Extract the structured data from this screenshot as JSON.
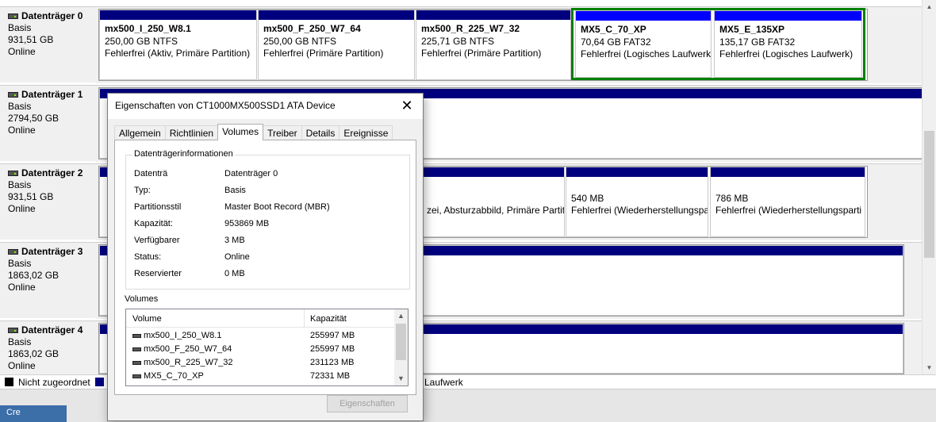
{
  "disks": [
    {
      "name": "Datenträger 0",
      "type": "Basis",
      "size": "931,51 GB",
      "status": "Online",
      "partitions": [
        {
          "name": "mx500_I_250_W8.1",
          "size": "250,00 GB NTFS",
          "status": "Fehlerfrei (Aktiv, Primäre Partition)"
        },
        {
          "name": "mx500_F_250_W7_64",
          "size": "250,00 GB NTFS",
          "status": "Fehlerfrei (Primäre Partition)"
        },
        {
          "name": "mx500_R_225_W7_32",
          "size": "225,71 GB NTFS",
          "status": "Fehlerfrei (Primäre Partition)"
        },
        {
          "name": "MX5_C_70_XP",
          "size": "70,64 GB FAT32",
          "status": "Fehlerfrei (Logisches Laufwerk"
        },
        {
          "name": "MX5_E_135XP",
          "size": "135,17 GB FAT32",
          "status": "Fehlerfrei (Logisches Laufwerk)"
        }
      ]
    },
    {
      "name": "Datenträger 1",
      "type": "Basis",
      "size": "2794,50 GB",
      "status": "Online"
    },
    {
      "name": "Datenträger 2",
      "type": "Basis",
      "size": "931,51 GB",
      "status": "Online",
      "partitions": [
        {
          "name": "",
          "size": "",
          "status": "zei, Absturzabbild, Primäre Partit"
        },
        {
          "name": "",
          "size": "540 MB",
          "status": "Fehlerfrei (Wiederherstellungspa"
        },
        {
          "name": "",
          "size": "786 MB",
          "status": "Fehlerfrei (Wiederherstellungsparti"
        }
      ]
    },
    {
      "name": "Datenträger 3",
      "type": "Basis",
      "size": "1863,02 GB",
      "status": "Online"
    },
    {
      "name": "Datenträger 4",
      "type": "Basis",
      "size": "1863,02 GB",
      "status": "Online"
    }
  ],
  "legend": {
    "unallocated": "Nicht zugeordnet",
    "logical": "es Laufwerk"
  },
  "taskbar": {
    "app_text": "Cre"
  },
  "dialog": {
    "title": "Eigenschaften von CT1000MX500SSD1 ATA Device",
    "close": "✕",
    "tabs": [
      "Allgemein",
      "Richtlinien",
      "Volumes",
      "Treiber",
      "Details",
      "Ereignisse"
    ],
    "active_tab": "Volumes",
    "group_title": "Datenträgerinformationen",
    "info": [
      {
        "k": "Datenträ",
        "v": "Datenträger 0"
      },
      {
        "k": "Typ:",
        "v": "Basis"
      },
      {
        "k": "Partitionsstil",
        "v": "Master Boot Record (MBR)"
      },
      {
        "k": "Kapazität:",
        "v": "953869 MB"
      },
      {
        "k": "Verfügbarer",
        "v": "3 MB"
      },
      {
        "k": "Status:",
        "v": "Online"
      },
      {
        "k": "Reservierter",
        "v": "0 MB"
      }
    ],
    "volumes_label": "Volumes",
    "columns": [
      "Volume",
      "Kapazität"
    ],
    "volumes": [
      {
        "name": "mx500_I_250_W8.1",
        "cap": "255997 MB"
      },
      {
        "name": "mx500_F_250_W7_64",
        "cap": "255997 MB"
      },
      {
        "name": "mx500_R_225_W7_32",
        "cap": "231123 MB"
      },
      {
        "name": "MX5_C_70_XP",
        "cap": "72331 MB"
      }
    ],
    "properties_button": "Eigenschaften"
  },
  "colors": {
    "primary_bar": "#00007f",
    "logical_bar": "#0000ff",
    "selection": "#008000"
  }
}
